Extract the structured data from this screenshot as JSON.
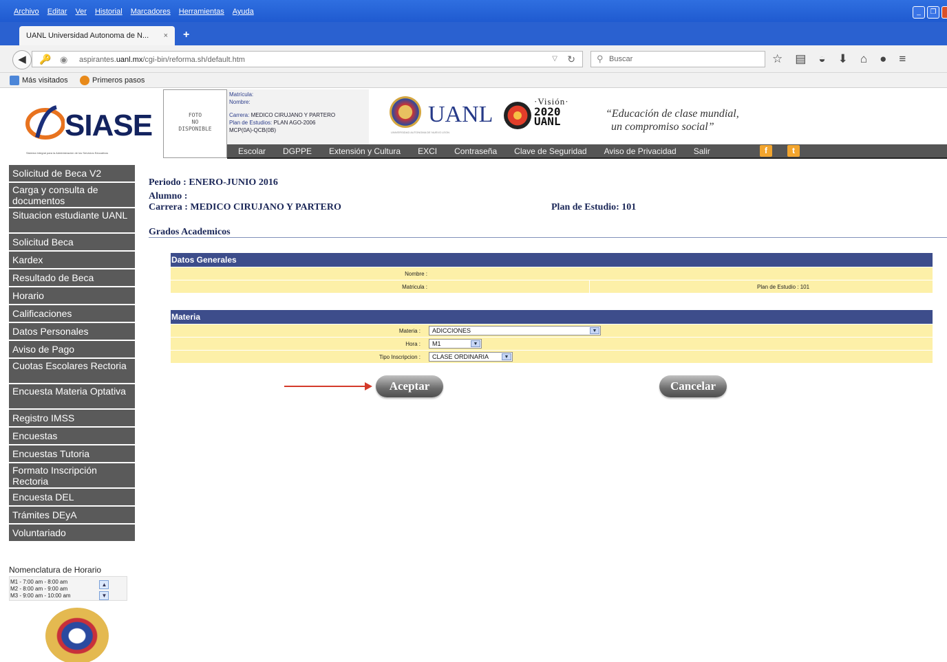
{
  "browser": {
    "menu": [
      "Archivo",
      "Editar",
      "Ver",
      "Historial",
      "Marcadores",
      "Herramientas",
      "Ayuda"
    ],
    "tab_title": "UANL Universidad Autonoma de N...",
    "tab_close": "×",
    "new_tab": "+",
    "url_prefix": "aspirantes.",
    "url_host": "uanl.mx",
    "url_path": "/cgi-bin/reforma.sh/default.htm",
    "search_placeholder": "Buscar",
    "bookmarks": [
      "Más visitados",
      "Primeros pasos"
    ]
  },
  "header": {
    "logo_text": "SIASE",
    "logo_tagline": "Sistema Integral para la Administración de los Servicios Educativos",
    "photo_text": [
      "FOTO",
      "NO",
      "DISPONIBLE"
    ],
    "matricula_label": "Matrícula:",
    "nombre_label": "Nombre:",
    "carrera_label": "Carrera:",
    "carrera_value": "MEDICO CIRUJANO Y PARTERO",
    "plan_label": "Plan de Estudios:",
    "plan_value": "PLAN AGO-2006",
    "plan_code": "MCP(0A)-QCB(0B)",
    "uanl_text": "UANL",
    "uanl_sub": "UNIVERSIDAD AUTONOMA DE NUEVO LEON",
    "vision_title": "·Visión·",
    "vision_year": "2020",
    "vision_uanl": "UANL",
    "slogan_line1": "“Educación de clase mundial,",
    "slogan_line2": "un compromiso social”",
    "nav": [
      "Escolar",
      "DGPPE",
      "Extensión y Cultura",
      "EXCI",
      "Contraseña",
      "Clave de Seguridad",
      "Aviso de Privacidad",
      "Salir"
    ],
    "fb_label": "f",
    "tw_label": "t"
  },
  "sidebar": {
    "items": [
      "Solicitud de Beca V2",
      "Carga y consulta de documentos",
      "Situacion estudiante UANL",
      "Solicitud Beca",
      "Kardex",
      "Resultado de Beca",
      "Horario",
      "Calificaciones",
      "Datos Personales",
      "Aviso de Pago",
      "Cuotas Escolares Rectoria",
      "Encuesta Materia Optativa",
      "Registro IMSS",
      "Encuestas",
      "Encuestas Tutoria",
      "Formato Inscripción Rectoria",
      "Encuesta DEL",
      "Trámites DEyA",
      "Voluntariado"
    ],
    "nomenclatura_title": "Nomenclatura de Horario",
    "nomenclatura": [
      "M1 - 7:00 am - 8:00 am",
      "M2 - 8:00 am - 9:00 am",
      "M3 - 9:00 am - 10:00 am"
    ]
  },
  "main": {
    "periodo": "Periodo :  ENERO-JUNIO 2016",
    "alumno": "Alumno :",
    "carrera": "Carrera :   MEDICO CIRUJANO Y PARTERO",
    "plan_estudio": "Plan de Estudio: 101",
    "grados": "Grados Academicos",
    "datos_title": "Datos Generales",
    "nombre_label": "Nombre :",
    "matricula_label": "Matricula :",
    "plan_label": "Plan de Estudio :  101",
    "materia_title": "Materia",
    "materia_label": "Materia :",
    "materia_value": "ADICCIONES",
    "hora_label": "Hora :",
    "hora_value": "M1",
    "tipo_label": "Tipo Inscripcion :",
    "tipo_value": "CLASE ORDINARIA",
    "aceptar": "Aceptar",
    "cancelar": "Cancelar"
  }
}
